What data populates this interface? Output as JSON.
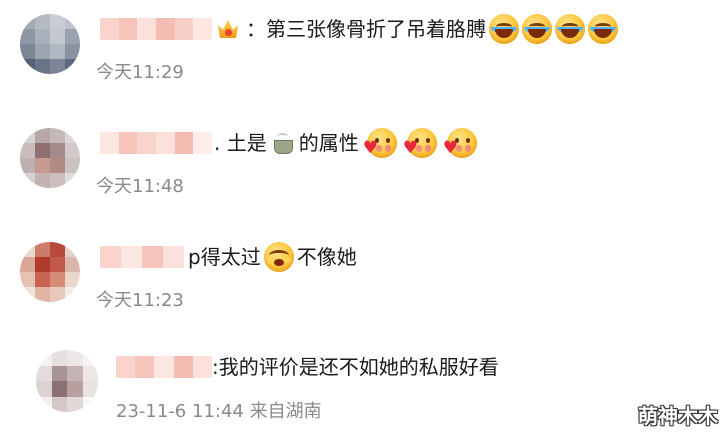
{
  "comments": [
    {
      "text": "：第三张像骨折了吊着胳膊",
      "time": "今天11:29",
      "emojis": [
        "laugh-cry-emoji",
        "laugh-cry-emoji",
        "laugh-cry-emoji",
        "laugh-cry-emoji"
      ],
      "badge": "crown-icon"
    },
    {
      "text_before": ". 土是",
      "text_after": "的属性",
      "time": "今天11:48",
      "emojis": [
        "blush-heart-emoji",
        "blush-heart-emoji",
        "blush-heart-emoji"
      ],
      "inline_icon": "tea-cup-icon"
    },
    {
      "text_before": "p得太过",
      "text_after": "不像她",
      "time": "今天11:23",
      "emojis": [
        "cover-face-emoji"
      ]
    }
  ],
  "reply": {
    "text": ":我的评价是还不如她的私服好看",
    "time": "23-11-6 11:44",
    "location": "来自湖南"
  },
  "watermark": "萌神木木",
  "colors": {
    "text": "#1a1a1a",
    "meta": "#8a8a8a",
    "name_blur": "#f7c5bd",
    "background": "#ffffff"
  }
}
